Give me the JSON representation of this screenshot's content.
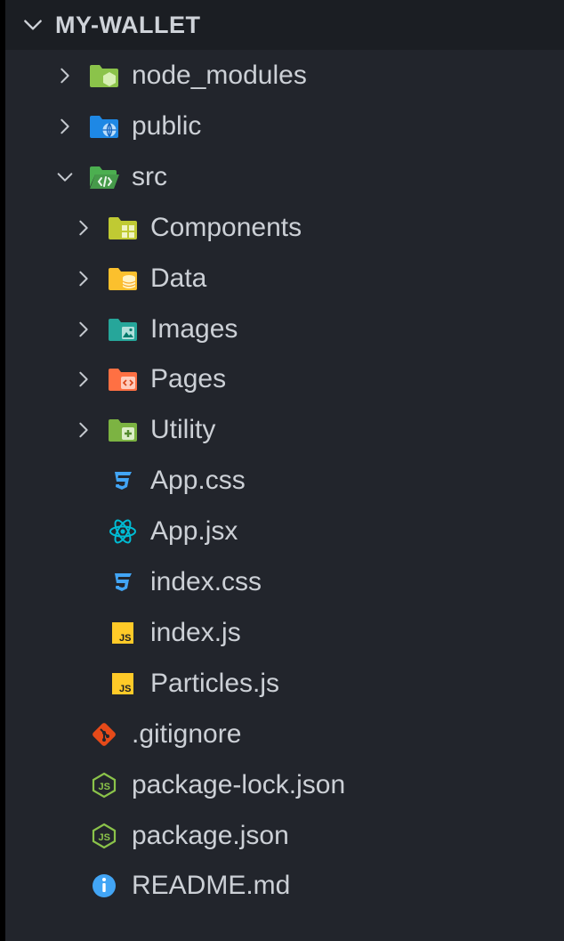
{
  "explorer": {
    "root_label": "MY-WALLET",
    "items": [
      {
        "label": "node_modules",
        "icon": "folder-node-icon",
        "type": "folder",
        "expanded": false,
        "depth": 1,
        "color": "#8bc34a"
      },
      {
        "label": "public",
        "icon": "folder-public-icon",
        "type": "folder",
        "expanded": false,
        "depth": 1,
        "color": "#1e88e5"
      },
      {
        "label": "src",
        "icon": "folder-src-open-icon",
        "type": "folder",
        "expanded": true,
        "depth": 1,
        "color": "#4caf50"
      },
      {
        "label": "Components",
        "icon": "folder-components-icon",
        "type": "folder",
        "expanded": false,
        "depth": 2,
        "color": "#c0ca33"
      },
      {
        "label": "Data",
        "icon": "folder-database-icon",
        "type": "folder",
        "expanded": false,
        "depth": 2,
        "color": "#fbc02d"
      },
      {
        "label": "Images",
        "icon": "folder-images-icon",
        "type": "folder",
        "expanded": false,
        "depth": 2,
        "color": "#26a69a"
      },
      {
        "label": "Pages",
        "icon": "folder-views-icon",
        "type": "folder",
        "expanded": false,
        "depth": 2,
        "color": "#ff7043"
      },
      {
        "label": "Utility",
        "icon": "folder-utils-icon",
        "type": "folder",
        "expanded": false,
        "depth": 2,
        "color": "#7cb342"
      },
      {
        "label": "App.css",
        "icon": "css-icon",
        "type": "file",
        "depth": 2,
        "color": "#42a5f5"
      },
      {
        "label": "App.jsx",
        "icon": "react-icon",
        "type": "file",
        "depth": 2,
        "color": "#00bcd4"
      },
      {
        "label": "index.css",
        "icon": "css-icon",
        "type": "file",
        "depth": 2,
        "color": "#42a5f5"
      },
      {
        "label": "index.js",
        "icon": "javascript-icon",
        "type": "file",
        "depth": 2,
        "color": "#ffca28"
      },
      {
        "label": "Particles.js",
        "icon": "javascript-icon",
        "type": "file",
        "depth": 2,
        "color": "#ffca28"
      },
      {
        "label": ".gitignore",
        "icon": "git-icon",
        "type": "file",
        "depth": 1,
        "color": "#e64a19"
      },
      {
        "label": "package-lock.json",
        "icon": "nodejs-icon",
        "type": "file",
        "depth": 1,
        "color": "#8bc34a"
      },
      {
        "label": "package.json",
        "icon": "nodejs-icon",
        "type": "file",
        "depth": 1,
        "color": "#8bc34a"
      },
      {
        "label": "README.md",
        "icon": "info-icon",
        "type": "file",
        "depth": 1,
        "color": "#42a5f5"
      }
    ]
  }
}
